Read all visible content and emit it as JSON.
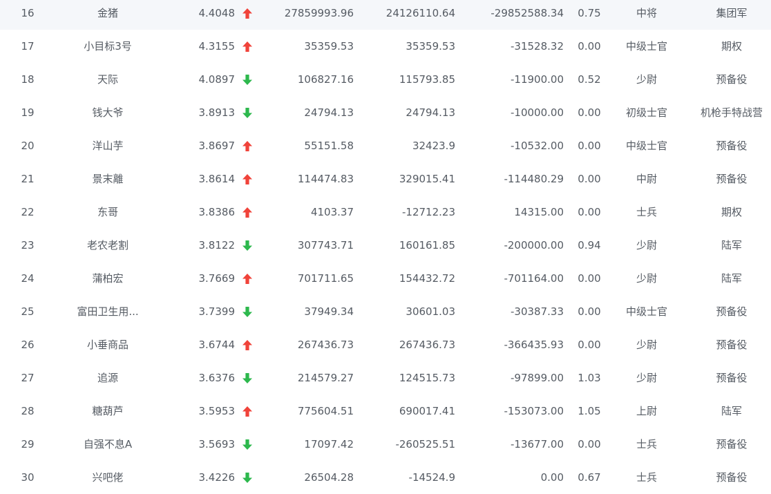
{
  "rows": [
    {
      "rank": "16",
      "name": "金猪",
      "score": "4.4048",
      "trend": "up",
      "v1": "27859993.96",
      "v2": "24126110.64",
      "v3": "-29852588.34",
      "ratio": "0.75",
      "level": "中将",
      "group": "集团军"
    },
    {
      "rank": "17",
      "name": "小目标3号",
      "score": "4.3155",
      "trend": "up",
      "v1": "35359.53",
      "v2": "35359.53",
      "v3": "-31528.32",
      "ratio": "0.00",
      "level": "中级士官",
      "group": "期权"
    },
    {
      "rank": "18",
      "name": "天际",
      "score": "4.0897",
      "trend": "down",
      "v1": "106827.16",
      "v2": "115793.85",
      "v3": "-11900.00",
      "ratio": "0.52",
      "level": "少尉",
      "group": "预备役"
    },
    {
      "rank": "19",
      "name": "钱大爷",
      "score": "3.8913",
      "trend": "down",
      "v1": "24794.13",
      "v2": "24794.13",
      "v3": "-10000.00",
      "ratio": "0.00",
      "level": "初级士官",
      "group": "机枪手特战营"
    },
    {
      "rank": "20",
      "name": "洋山芋",
      "score": "3.8697",
      "trend": "up",
      "v1": "55151.58",
      "v2": "32423.9",
      "v3": "-10532.00",
      "ratio": "0.00",
      "level": "中级士官",
      "group": "预备役"
    },
    {
      "rank": "21",
      "name": "景末離",
      "score": "3.8614",
      "trend": "up",
      "v1": "114474.83",
      "v2": "329015.41",
      "v3": "-114480.29",
      "ratio": "0.00",
      "level": "中尉",
      "group": "预备役"
    },
    {
      "rank": "22",
      "name": "东哥",
      "score": "3.8386",
      "trend": "up",
      "v1": "4103.37",
      "v2": "-12712.23",
      "v3": "14315.00",
      "ratio": "0.00",
      "level": "士兵",
      "group": "期权"
    },
    {
      "rank": "23",
      "name": "老农老割",
      "score": "3.8122",
      "trend": "down",
      "v1": "307743.71",
      "v2": "160161.85",
      "v3": "-200000.00",
      "ratio": "0.94",
      "level": "少尉",
      "group": "陆军"
    },
    {
      "rank": "24",
      "name": "蒲柏宏",
      "score": "3.7669",
      "trend": "up",
      "v1": "701711.65",
      "v2": "154432.72",
      "v3": "-701164.00",
      "ratio": "0.00",
      "level": "少尉",
      "group": "陆军"
    },
    {
      "rank": "25",
      "name": "富田卫生用...",
      "score": "3.7399",
      "trend": "down",
      "v1": "37949.34",
      "v2": "30601.03",
      "v3": "-30387.33",
      "ratio": "0.00",
      "level": "中级士官",
      "group": "预备役"
    },
    {
      "rank": "26",
      "name": "小垂商品",
      "score": "3.6744",
      "trend": "up",
      "v1": "267436.73",
      "v2": "267436.73",
      "v3": "-366435.93",
      "ratio": "0.00",
      "level": "少尉",
      "group": "预备役"
    },
    {
      "rank": "27",
      "name": "追源",
      "score": "3.6376",
      "trend": "down",
      "v1": "214579.27",
      "v2": "124515.73",
      "v3": "-97899.00",
      "ratio": "1.03",
      "level": "少尉",
      "group": "预备役"
    },
    {
      "rank": "28",
      "name": "糖葫芦",
      "score": "3.5953",
      "trend": "up",
      "v1": "775604.51",
      "v2": "690017.41",
      "v3": "-153073.00",
      "ratio": "1.05",
      "level": "上尉",
      "group": "陆军"
    },
    {
      "rank": "29",
      "name": "自强不息A",
      "score": "3.5693",
      "trend": "down",
      "v1": "17097.42",
      "v2": "-260525.51",
      "v3": "-13677.00",
      "ratio": "0.00",
      "level": "士兵",
      "group": "预备役"
    },
    {
      "rank": "30",
      "name": "兴吧佬",
      "score": "3.4226",
      "trend": "down",
      "v1": "26504.28",
      "v2": "-14524.9",
      "v3": "0.00",
      "ratio": "0.67",
      "level": "士兵",
      "group": "预备役"
    }
  ],
  "colors": {
    "up": "#f0433a",
    "down": "#2db84d",
    "text": "#555b63"
  },
  "icons": {
    "up": "arrow-up-icon",
    "down": "arrow-down-icon"
  }
}
